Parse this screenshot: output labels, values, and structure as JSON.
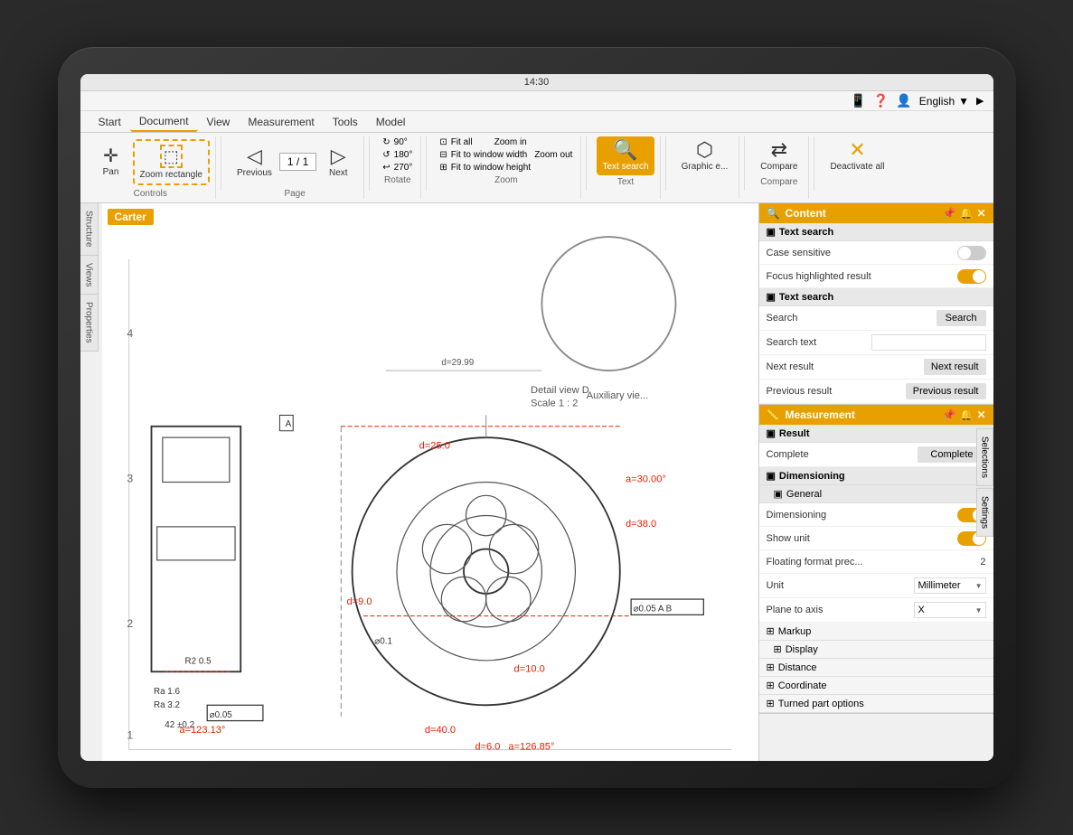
{
  "statusBar": {
    "time": "14:30"
  },
  "topBar": {
    "language": "English",
    "icons": [
      "tablet-icon",
      "help-icon",
      "account-icon"
    ]
  },
  "menuBar": {
    "items": [
      "Start",
      "Document",
      "View",
      "Measurement",
      "Tools",
      "Model"
    ]
  },
  "toolbar": {
    "groups": [
      {
        "label": "Controls",
        "buttons": [
          {
            "icon": "✛",
            "label": "Pan",
            "active": false
          },
          {
            "icon": "⬚",
            "label": "Zoom rectangle",
            "active": false
          }
        ]
      },
      {
        "label": "Page",
        "buttons": [
          {
            "icon": "◁",
            "label": "Previous",
            "active": false
          },
          {
            "icon": "1 / 1",
            "label": "",
            "active": false
          },
          {
            "icon": "▷",
            "label": "Next",
            "active": false
          }
        ]
      },
      {
        "label": "Rotate",
        "items": [
          "90°",
          "180°",
          "270°"
        ]
      },
      {
        "label": "Zoom",
        "items": [
          "Fit all",
          "Fit to window width",
          "Fit to window height",
          "Zoom in",
          "Zoom out"
        ]
      },
      {
        "label": "Text",
        "buttons": [
          {
            "icon": "🔍",
            "label": "Text search",
            "active": true
          }
        ]
      },
      {
        "label": "",
        "buttons": [
          {
            "icon": "⬡",
            "label": "Graphic e...",
            "active": false
          }
        ]
      },
      {
        "label": "Compare",
        "buttons": [
          {
            "icon": "⇄",
            "label": "Compare",
            "active": false
          }
        ]
      },
      {
        "label": "",
        "buttons": [
          {
            "icon": "✕",
            "label": "Deactivate all",
            "active": false
          }
        ]
      }
    ]
  },
  "leftSidebar": {
    "tabs": [
      "Structure",
      "Views",
      "Properties"
    ]
  },
  "drawingLabel": "Carter",
  "rightPanels": {
    "contentPanel": {
      "title": "Content",
      "textSearch1": {
        "label": "Text search",
        "caseSensitive": {
          "label": "Case sensitive",
          "value": false
        },
        "focusHighlighted": {
          "label": "Focus highlighted result",
          "value": true
        }
      },
      "textSearch2": {
        "label": "Text search",
        "search": {
          "label": "Search",
          "buttonLabel": "Search"
        },
        "searchText": {
          "label": "Search text"
        },
        "nextResult": {
          "label": "Next result",
          "buttonLabel": "Next result"
        },
        "prevResult": {
          "label": "Previous result",
          "buttonLabel": "Previous result"
        }
      }
    },
    "measurementPanel": {
      "title": "Measurement",
      "result": {
        "label": "Result",
        "complete": {
          "label": "Complete",
          "buttonLabel": "Complete"
        }
      },
      "dimensioning": {
        "label": "Dimensioning",
        "general": {
          "label": "General",
          "dimensioning": {
            "label": "Dimensioning",
            "value": true
          },
          "showUnit": {
            "label": "Show unit",
            "value": true
          },
          "floatingFormat": {
            "label": "Floating format prec...",
            "value": "2"
          },
          "unit": {
            "label": "Unit",
            "value": "Millimeter"
          },
          "planeToAxis": {
            "label": "Plane to axis",
            "value": "X"
          }
        }
      },
      "markup": {
        "label": "Markup"
      },
      "display": {
        "label": "Display"
      },
      "distance": {
        "label": "Distance"
      },
      "coordinate": {
        "label": "Coordinate"
      },
      "turnedPartOptions": {
        "label": "Turned part options"
      }
    }
  },
  "rightSidebarTabs": [
    "Selections",
    "Settings"
  ]
}
